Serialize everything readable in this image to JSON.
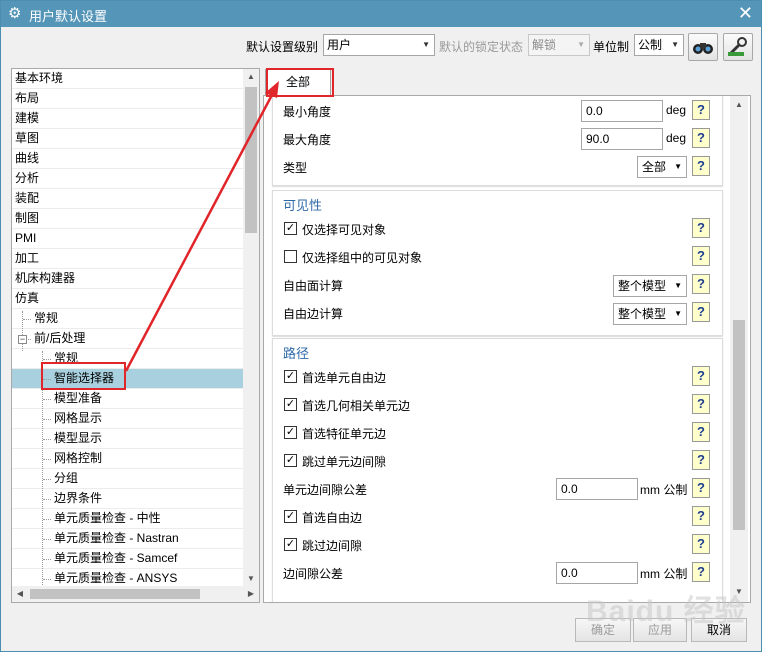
{
  "window": {
    "title": "用户默认设置",
    "close_glyph": "✕",
    "icon": "gear-icon"
  },
  "toolbar": {
    "level_label": "默认设置级别",
    "level_value": "用户",
    "lock_label": "默认的锁定状态",
    "lock_value": "解锁",
    "unit_label": "单位制",
    "unit_value": "公制"
  },
  "tree": {
    "items": [
      {
        "label": "基本环境",
        "level": 0
      },
      {
        "label": "布局",
        "level": 0
      },
      {
        "label": "建模",
        "level": 0
      },
      {
        "label": "草图",
        "level": 0
      },
      {
        "label": "曲线",
        "level": 0
      },
      {
        "label": "分析",
        "level": 0
      },
      {
        "label": "装配",
        "level": 0
      },
      {
        "label": "制图",
        "level": 0
      },
      {
        "label": "PMI",
        "level": 0
      },
      {
        "label": "加工",
        "level": 0
      },
      {
        "label": "机床构建器",
        "level": 0
      },
      {
        "label": "仿真",
        "level": 0
      },
      {
        "label": "常规",
        "level": 1
      },
      {
        "label": "前/后处理",
        "level": 1
      },
      {
        "label": "常规",
        "level": 2
      },
      {
        "label": "智能选择器",
        "level": 2,
        "selected": true
      },
      {
        "label": "模型准备",
        "level": 2
      },
      {
        "label": "网格显示",
        "level": 2
      },
      {
        "label": "模型显示",
        "level": 2
      },
      {
        "label": "网格控制",
        "level": 2
      },
      {
        "label": "分组",
        "level": 2
      },
      {
        "label": "边界条件",
        "level": 2
      },
      {
        "label": "单元质量检查 - 中性",
        "level": 2
      },
      {
        "label": "单元质量检查 - Nastran",
        "level": 2
      },
      {
        "label": "单元质量检查 - Samcef",
        "level": 2
      },
      {
        "label": "单元质量检查 - ANSYS",
        "level": 2
      }
    ]
  },
  "tabs": [
    {
      "label": "全部"
    }
  ],
  "group1": {
    "min_angle_label": "最小角度",
    "min_angle_value": "0.0",
    "min_angle_unit": "deg",
    "max_angle_label": "最大角度",
    "max_angle_value": "90.0",
    "max_angle_unit": "deg",
    "type_label": "类型",
    "type_value": "全部"
  },
  "group2": {
    "title": "可见性",
    "only_visible_label": "仅选择可见对象",
    "only_visible_checked": true,
    "group_visible_label": "仅选择组中的可见对象",
    "group_visible_checked": false,
    "face_calc_label": "自由面计算",
    "face_calc_value": "整个模型",
    "edge_calc_label": "自由边计算",
    "edge_calc_value": "整个模型"
  },
  "group3": {
    "title": "路径",
    "pref_free_edge_label": "首选单元自由边",
    "pref_geo_edge_label": "首选几何相关单元边",
    "pref_feature_edge_label": "首选特征单元边",
    "skip_gap_label": "跳过单元边间隙",
    "gap_tol_label": "单元边间隙公差",
    "gap_tol_value": "0.0",
    "gap_tol_unit": "mm 公制",
    "pref_free_label": "首选自由边",
    "skip_edge_gap_label": "跳过边间隙",
    "edge_gap_tol_label": "边间隙公差",
    "edge_gap_tol_value": "0.0",
    "edge_gap_tol_unit": "mm 公制"
  },
  "buttons": {
    "ok": "确定",
    "apply": "应用",
    "cancel": "取消"
  },
  "help_glyph": "?",
  "watermark": "Baidu 经验",
  "colors": {
    "titlebar": "#5596b8",
    "selection": "#a9d0de",
    "annotation": "#e0252b",
    "group_title": "#2f6aa8"
  }
}
